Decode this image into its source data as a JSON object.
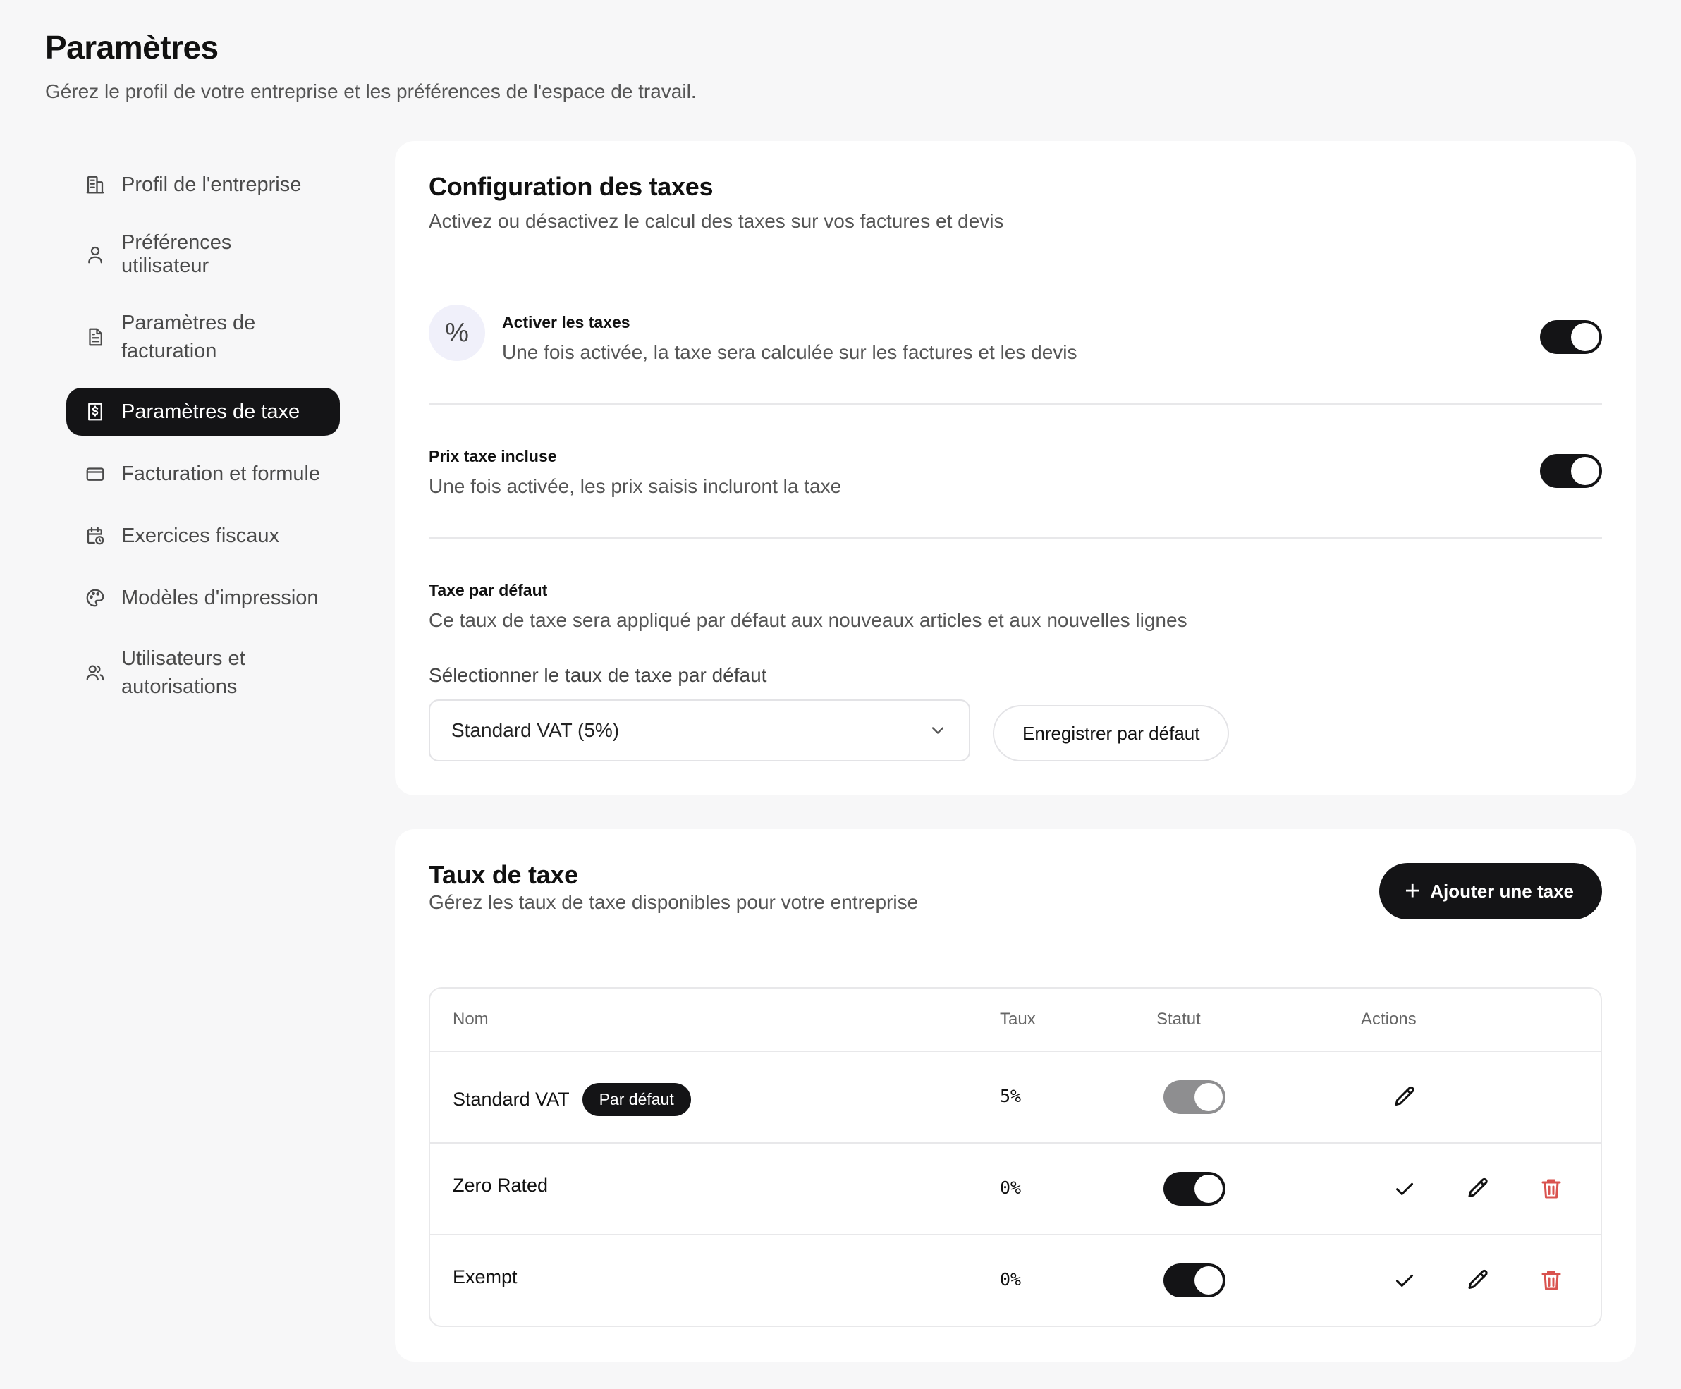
{
  "page": {
    "title": "Paramètres",
    "subtitle": "Gérez le profil de votre entreprise et les préférences de l'espace de travail."
  },
  "sidebar": {
    "items": [
      {
        "label": "Profil de l'entreprise",
        "icon": "building-icon"
      },
      {
        "label": "Préférences utilisateur",
        "icon": "user-icon"
      },
      {
        "label_line1": "Paramètres de",
        "label_line2": "facturation",
        "icon": "document-icon"
      },
      {
        "label": "Paramètres de taxe",
        "icon": "receipt-dollar-icon",
        "active": true
      },
      {
        "label": "Facturation et formule",
        "icon": "credit-card-icon"
      },
      {
        "label": "Exercices fiscaux",
        "icon": "calendar-clock-icon"
      },
      {
        "label": "Modèles d'impression",
        "icon": "palette-icon"
      },
      {
        "label_line1": "Utilisateurs et",
        "label_line2": "autorisations",
        "icon": "users-icon"
      }
    ]
  },
  "tax_config": {
    "title": "Configuration des taxes",
    "description": "Activez ou désactivez le calcul des taxes sur vos factures et devis",
    "enable": {
      "icon_glyph": "%",
      "label": "Activer les taxes",
      "description": "Une fois activée, la taxe sera calculée sur les factures et les devis",
      "enabled": true
    },
    "inclusive": {
      "label": "Prix taxe incluse",
      "description": "Une fois activée, les prix saisis incluront la taxe",
      "enabled": true
    },
    "default_tax": {
      "label": "Taxe par défaut",
      "description": "Ce taux de taxe sera appliqué par défaut aux nouveaux articles et aux nouvelles lignes",
      "select_label": "Sélectionner le taux de taxe par défaut",
      "selected": "Standard VAT (5%)",
      "save_label": "Enregistrer par défaut"
    }
  },
  "tax_rates": {
    "title": "Taux de taxe",
    "description": "Gérez les taux de taxe disponibles pour votre entreprise",
    "add_label": "Ajouter une taxe",
    "columns": [
      "Nom",
      "Taux",
      "Statut",
      "Actions"
    ],
    "rows": [
      {
        "name": "Standard VAT",
        "badge": "Par défaut",
        "rate": "5%",
        "active": true,
        "locked": true
      },
      {
        "name": "Zero Rated",
        "rate": "0%",
        "active": true
      },
      {
        "name": "Exempt",
        "rate": "0%",
        "active": true
      }
    ]
  },
  "colors": {
    "accent": "#141416",
    "background": "#f7f7f8",
    "danger": "#d9534f",
    "toggle_disabled": "#8e8e90"
  }
}
